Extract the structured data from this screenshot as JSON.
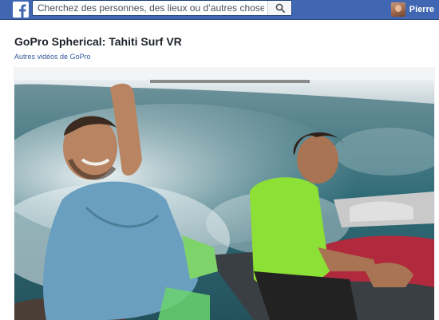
{
  "topbar": {
    "logo_icon": "facebook-f-icon",
    "search_placeholder": "Cherchez des personnes, des lieux ou d’autres choses",
    "search_icon": "search-icon",
    "user_name": "Pierre",
    "brand_color": "#4267b2"
  },
  "video": {
    "title": "GoPro Spherical: Tahiti Surf VR",
    "more_link": "Autres vidéos de GoPro"
  }
}
